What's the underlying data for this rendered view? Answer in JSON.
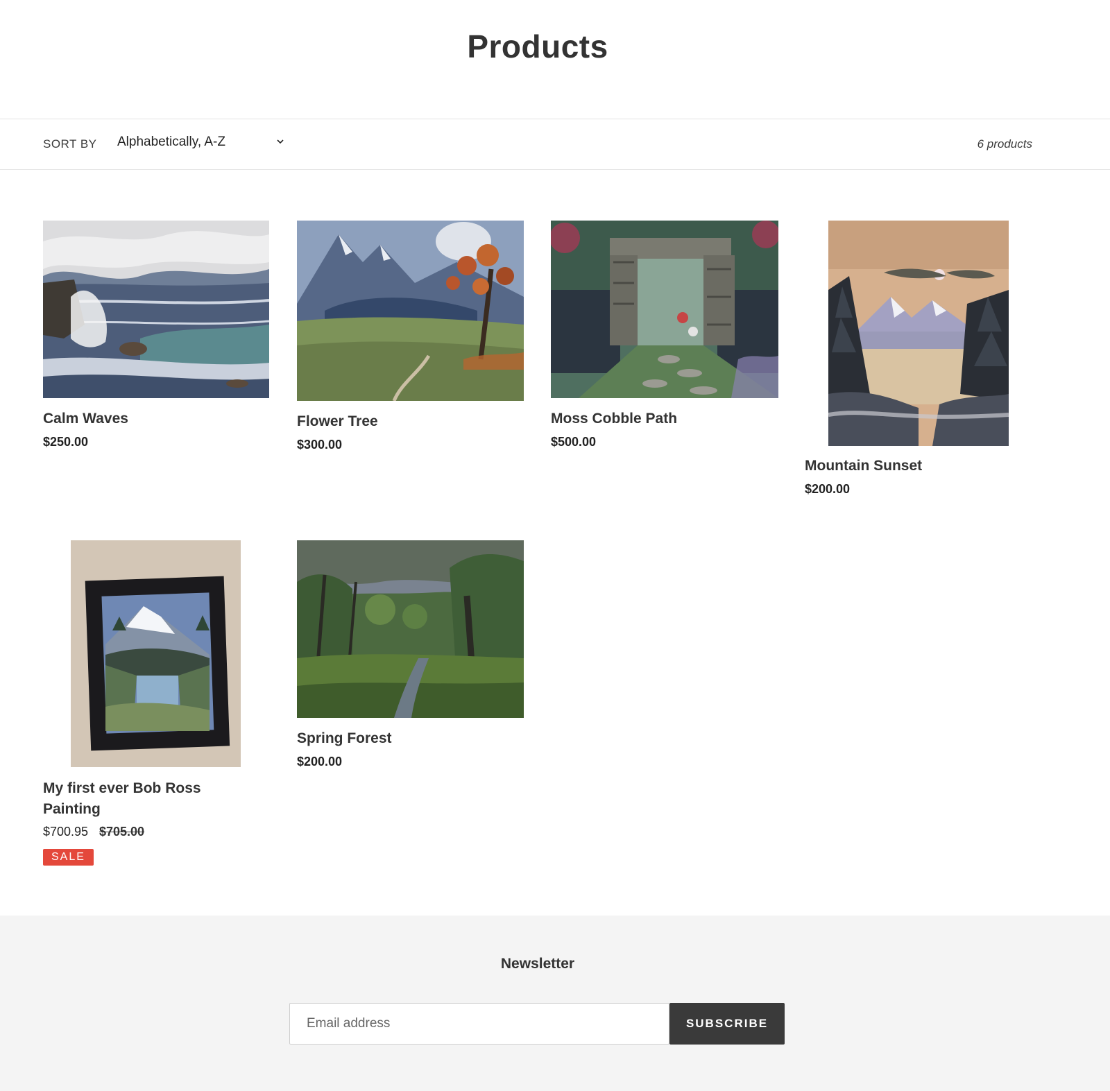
{
  "page": {
    "title": "Products"
  },
  "toolbar": {
    "sort_label": "SORT BY",
    "sort_value": "Alphabetically, A-Z",
    "product_count": "6 products"
  },
  "products": [
    {
      "title": "Calm Waves",
      "price": "$250.00"
    },
    {
      "title": "Flower Tree",
      "price": "$300.00"
    },
    {
      "title": "Moss Cobble Path",
      "price": "$500.00"
    },
    {
      "title": "Mountain Sunset",
      "price": "$200.00"
    },
    {
      "title": "My first ever Bob Ross Painting",
      "sale_price": "$700.95",
      "compare_price": "$705.00",
      "badge": "SALE"
    },
    {
      "title": "Spring Forest",
      "price": "$200.00"
    }
  ],
  "newsletter": {
    "title": "Newsletter",
    "email_placeholder": "Email address",
    "subscribe_label": "SUBSCRIBE"
  },
  "colors": {
    "sale": "#e4483b",
    "button": "#3a3a3a",
    "footer_bg": "#f4f4f4"
  }
}
